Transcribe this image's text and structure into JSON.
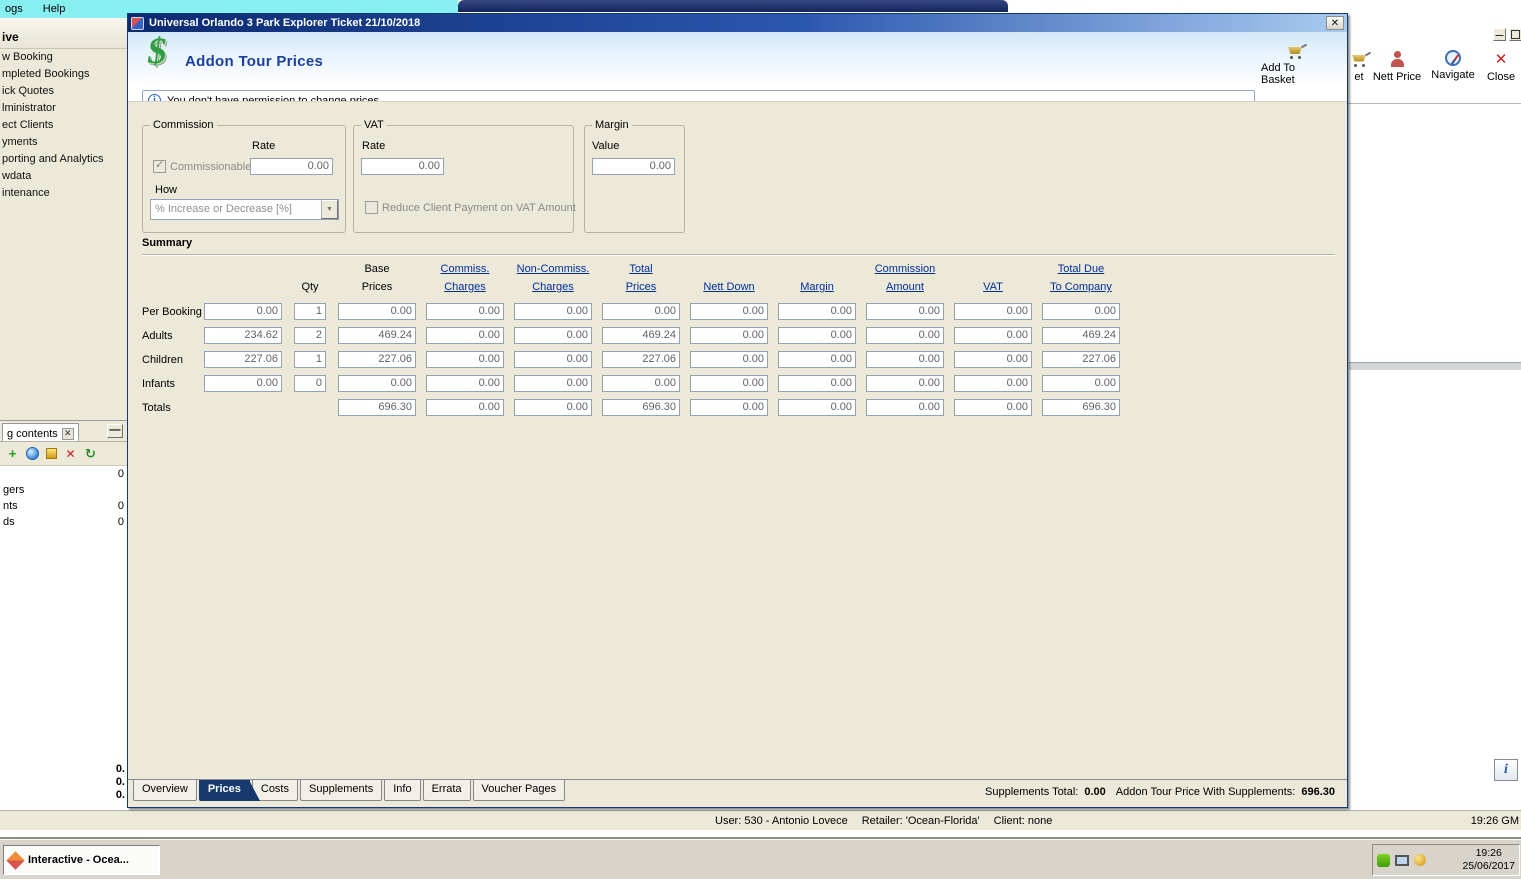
{
  "icons": {
    "x": "✕",
    "arrow_down": "▼",
    "check": "✓",
    "dash": "—",
    "info": "i",
    "dollar": "$",
    "plus": "+",
    "refresh": "↻"
  },
  "menu": {
    "items": [
      "ogs",
      "Help"
    ]
  },
  "sidebar": {
    "header": "ive",
    "items": [
      "w Booking",
      "mpleted Bookings",
      "ick Quotes",
      "lministrator",
      "ect Clients",
      "yments",
      "porting and Analytics",
      "wdata",
      "intenance"
    ]
  },
  "left_panel": {
    "tab_label": "g contents",
    "rows": [
      {
        "label": "",
        "value": "0"
      },
      {
        "label": "gers",
        "value": ""
      },
      {
        "label": "nts",
        "value": "0"
      },
      {
        "label": "ds",
        "value": "0"
      }
    ],
    "bottom_values": [
      "0.",
      "0.",
      "0."
    ]
  },
  "right_toolbar": {
    "buttons": [
      {
        "label": "et",
        "icon": "basket-icon"
      },
      {
        "label": "Nett Price",
        "icon": "nett-price-icon"
      },
      {
        "label": "Navigate",
        "icon": "navigate-icon"
      },
      {
        "label": "Close",
        "icon": "close-icon"
      }
    ]
  },
  "dialog": {
    "title": "Universal Orlando 3 Park Explorer Ticket 21/10/2018",
    "header_title": "Addon Tour Prices",
    "add_to_basket_label": "Add To Basket",
    "notice": "You don't have permission to change prices",
    "commission": {
      "title": "Commission",
      "rate_label": "Rate",
      "commissionable_label": "Commissionable",
      "rate_value": "0.00",
      "how_label": "How",
      "how_value": "% Increase or Decrease  [%]"
    },
    "vat": {
      "title": "VAT",
      "rate_label": "Rate",
      "rate_value": "0.00",
      "reduce_label": "Reduce Client Payment on VAT Amount"
    },
    "margin": {
      "title": "Margin",
      "value_label": "Value",
      "value": "0.00"
    },
    "summary": {
      "title": "Summary",
      "columns": [
        {
          "line1": "",
          "line2": "Qty",
          "link": false
        },
        {
          "line1": "Base",
          "line2": "Prices",
          "link": false
        },
        {
          "line1": "Commiss.",
          "line2": "Charges",
          "link": true
        },
        {
          "line1": "Non-Commiss.",
          "line2": "Charges",
          "link": true
        },
        {
          "line1": "Total",
          "line2": "Prices",
          "link": true
        },
        {
          "line1": "",
          "line2": "Nett Down",
          "link": true
        },
        {
          "line1": "",
          "line2": "Margin",
          "link": true
        },
        {
          "line1": "Commission",
          "line2": "Amount",
          "link": true
        },
        {
          "line1": "",
          "line2": "VAT",
          "link": true
        },
        {
          "line1": "Total Due",
          "line2": "To Company",
          "link": true
        }
      ],
      "rows": [
        {
          "label": "Per Booking",
          "cells": [
            "0.00",
            "1",
            "0.00",
            "0.00",
            "0.00",
            "0.00",
            "0.00",
            "0.00",
            "0.00",
            "0.00",
            "0.00"
          ]
        },
        {
          "label": "Adults",
          "cells": [
            "234.62",
            "2",
            "469.24",
            "0.00",
            "0.00",
            "469.24",
            "0.00",
            "0.00",
            "0.00",
            "0.00",
            "469.24"
          ]
        },
        {
          "label": "Children",
          "cells": [
            "227.06",
            "1",
            "227.06",
            "0.00",
            "0.00",
            "227.06",
            "0.00",
            "0.00",
            "0.00",
            "0.00",
            "227.06"
          ]
        },
        {
          "label": "Infants",
          "cells": [
            "0.00",
            "0",
            "0.00",
            "0.00",
            "0.00",
            "0.00",
            "0.00",
            "0.00",
            "0.00",
            "0.00",
            "0.00"
          ]
        },
        {
          "label": "Totals",
          "cells": [
            null,
            null,
            "696.30",
            "0.00",
            "0.00",
            "696.30",
            "0.00",
            "0.00",
            "0.00",
            "0.00",
            "696.30"
          ]
        }
      ]
    },
    "tabs": {
      "items": [
        "Overview",
        "Prices",
        "Costs",
        "Supplements",
        "Info",
        "Errata",
        "Voucher Pages"
      ],
      "active": "Prices"
    },
    "footer": {
      "supplements_total_label": "Supplements Total:",
      "supplements_total": "0.00",
      "with_supplements_label": "Addon Tour Price With Supplements:",
      "with_supplements": "696.30"
    }
  },
  "status_bar": {
    "user": "User: 530 - Antonio Lovece",
    "retailer": "Retailer: 'Ocean-Florida'",
    "client": "Client: none",
    "time": "19:26 GM"
  },
  "taskbar": {
    "app_button": "Interactive - Ocea...",
    "tray_time": "19:26",
    "tray_date": "25/06/2017"
  }
}
